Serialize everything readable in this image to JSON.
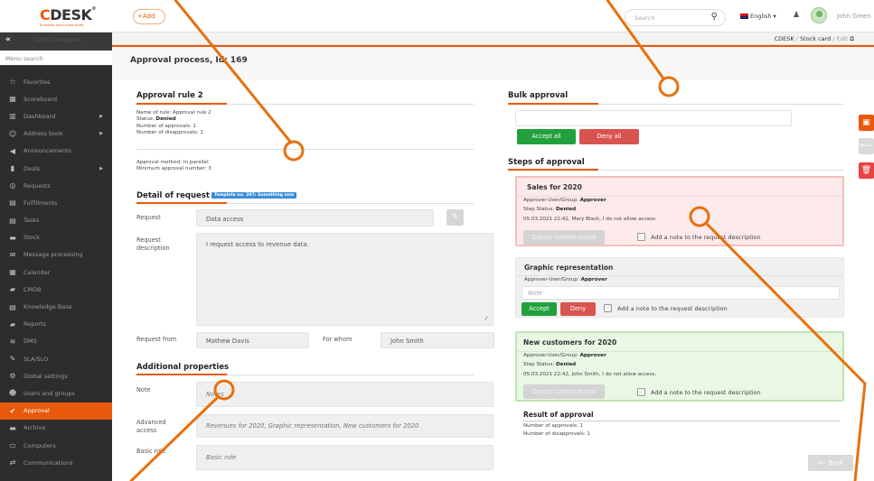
{
  "app": {
    "logo_brand": "CDESK",
    "logo_mark": "®",
    "logo_tagline": "Empower work-make profit",
    "add_label": "Add"
  },
  "topbar": {
    "search_placeholder": "Search",
    "language": "English",
    "user_name": "John Green"
  },
  "sidebar": {
    "nav_title": "CDESK navigation",
    "menu_search_placeholder": "Menu search",
    "items": [
      {
        "label": "Favorites",
        "icon": "star-icon",
        "glyph": "☆"
      },
      {
        "label": "Scoreboard",
        "icon": "scoreboard-icon",
        "glyph": "▦"
      },
      {
        "label": "Dashboard",
        "icon": "chart-icon",
        "glyph": "▥",
        "arrow": true
      },
      {
        "label": "Address book",
        "icon": "person-icon",
        "glyph": "☺",
        "arrow": true
      },
      {
        "label": "Announcements",
        "icon": "megaphone-icon",
        "glyph": "◀"
      },
      {
        "label": "Deals",
        "icon": "deals-icon",
        "glyph": "▮",
        "arrow": true
      },
      {
        "label": "Requests",
        "icon": "requests-icon",
        "glyph": "◎"
      },
      {
        "label": "Fulfillments",
        "icon": "fulfillments-icon",
        "glyph": "▤"
      },
      {
        "label": "Tasks",
        "icon": "tasks-icon",
        "glyph": "▤"
      },
      {
        "label": "Stock",
        "icon": "stock-icon",
        "glyph": "▬"
      },
      {
        "label": "Message processing",
        "icon": "envelope-icon",
        "glyph": "✉"
      },
      {
        "label": "Calendar",
        "icon": "calendar-icon",
        "glyph": "▦"
      },
      {
        "label": "CMDB",
        "icon": "folder-icon",
        "glyph": "▰"
      },
      {
        "label": "Knowledge Base",
        "icon": "book-icon",
        "glyph": "▤"
      },
      {
        "label": "Reports",
        "icon": "folder-open-icon",
        "glyph": "▰"
      },
      {
        "label": "DMS",
        "icon": "database-icon",
        "glyph": "≋"
      },
      {
        "label": "SLA/SLO",
        "icon": "sla-icon",
        "glyph": "✎"
      },
      {
        "label": "Global settings",
        "icon": "gears-icon",
        "glyph": "⚙"
      },
      {
        "label": "Users and groups",
        "icon": "users-icon",
        "glyph": "☻"
      },
      {
        "label": "Approval",
        "icon": "approval-icon",
        "glyph": "✔",
        "active": true
      },
      {
        "label": "Archive",
        "icon": "archive-icon",
        "glyph": "▬"
      },
      {
        "label": "Computers",
        "icon": "laptop-icon",
        "glyph": "▭"
      },
      {
        "label": "Communications",
        "icon": "exchange-icon",
        "glyph": "⇄"
      }
    ]
  },
  "breadcrumb": {
    "root": "CDESK",
    "sep": "/",
    "page": "Stock card",
    "edit": "Edit"
  },
  "page": {
    "title": "Approval process, Id: 169"
  },
  "rule": {
    "title": "Approval rule 2",
    "name_line": "Name of rule: Approval rule 2",
    "status_label": "Status:",
    "status_value": "Denied",
    "approvals": "Number of approvals: 1",
    "disapprovals": "Number of disapprovals: 1",
    "method": "Approval method: In parallel",
    "min_number": "Minimum approval number: 3"
  },
  "detail": {
    "title": "Detail of request",
    "template_badge": "Template no. 207: Something new",
    "request_label": "Request",
    "request_value": "Data access",
    "description_label_1": "Request",
    "description_label_2": "description",
    "description_value": "I request access to revenue data.",
    "from_label": "Request from",
    "from_value": "Mathew Davis",
    "whom_label": "For whom",
    "whom_value": "John Smith"
  },
  "additional": {
    "title": "Additional properties",
    "note_label": "Note",
    "note_placeholder": "Notes",
    "advanced_label_1": "Advanced",
    "advanced_label_2": "access",
    "advanced_value": "Revenues for 2020, Graphic representation, New customers for 2020",
    "basic_label": "Basic role",
    "basic_value": "Basic role"
  },
  "bulk": {
    "title": "Bulk approval",
    "accept_all": "Accept all",
    "deny_all": "Deny all"
  },
  "steps": {
    "title": "Steps of approval",
    "cards": [
      {
        "title": "Sales for 2020",
        "approver_label": "Approver-User/Group:",
        "approver_value": "Approver",
        "status_label": "Step Status:",
        "status_value": "Denied",
        "history": "05.03.2021 22:42, Mary Black, I do not allow access.",
        "cancel": "Cancel current status",
        "note_chk": "Add a note to the request description"
      },
      {
        "title": "Graphic representation",
        "approver_label": "Approver-User/Group:",
        "approver_value": "Approver",
        "note_placeholder": "Note",
        "accept": "Accept",
        "deny": "Deny",
        "note_chk": "Add a note to the request description"
      },
      {
        "title": "New customers for 2020",
        "approver_label": "Approver-User/Group:",
        "approver_value": "Approver",
        "status_label": "Step Status:",
        "status_value": "Denied",
        "history": "05.03.2021 22:42, John Smith, I do not allow access.",
        "cancel": "Cancel current status",
        "note_chk": "Add a note to the request description"
      }
    ],
    "result_title": "Result of approval",
    "result_approvals": "Number of approvals: 1",
    "result_disapprovals": "Number of disapprovals: 1"
  },
  "back_label": "Back",
  "colors": {
    "accent": "#e8590c",
    "sidebar_bg": "#2d2d2d",
    "green": "#22a03c",
    "red": "#d9534f",
    "annotation": "#e8700c"
  }
}
